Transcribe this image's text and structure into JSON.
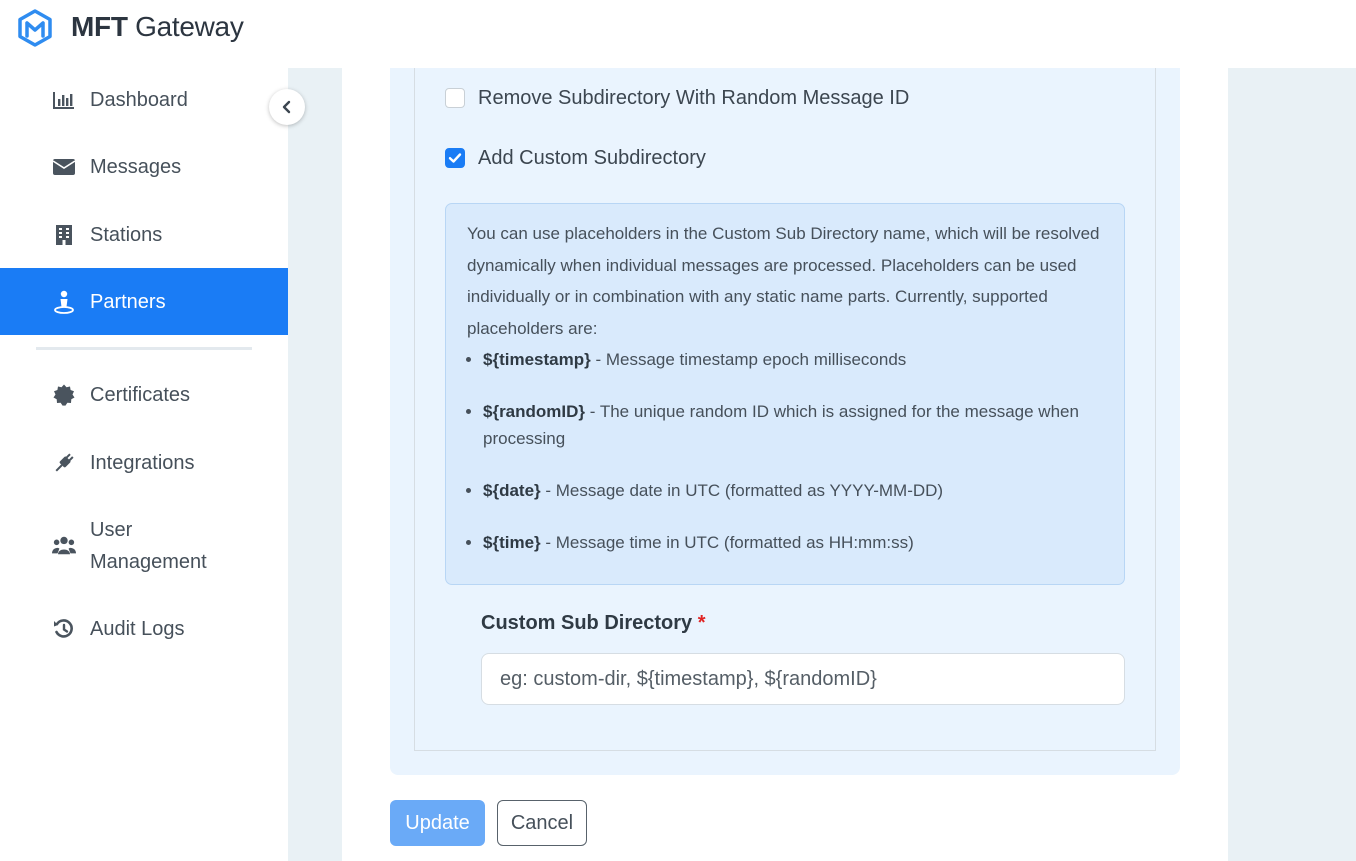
{
  "app": {
    "title_bold": "MFT",
    "title_light": "Gateway"
  },
  "sidebar": {
    "items": [
      {
        "label": "Dashboard",
        "icon": "bar-chart-icon"
      },
      {
        "label": "Messages",
        "icon": "envelope-icon"
      },
      {
        "label": "Stations",
        "icon": "building-icon"
      },
      {
        "label": "Partners",
        "icon": "user-pin-icon",
        "active": true
      },
      {
        "label": "Certificates",
        "icon": "certificate-icon"
      },
      {
        "label": "Integrations",
        "icon": "plug-icon"
      },
      {
        "label": "User",
        "label_line2": "Management",
        "icon": "users-icon"
      },
      {
        "label": "Audit Logs",
        "icon": "history-icon"
      }
    ],
    "collapse_icon": "chevron-left-icon"
  },
  "form": {
    "remove_subdir_label": "Remove Subdirectory With Random Message ID",
    "remove_subdir_checked": false,
    "add_custom_label": "Add Custom Subdirectory",
    "add_custom_checked": true,
    "info": {
      "intro": "You can use placeholders in the Custom Sub Directory name, which will be resolved dynamically when individual messages are processed. Placeholders can be used individually or in combination with any static name parts. Currently, supported placeholders are:",
      "placeholders": [
        {
          "key": "${timestamp}",
          "desc": " - Message timestamp epoch milliseconds"
        },
        {
          "key": "${randomID}",
          "desc": " - The unique random ID which is assigned for the message when processing"
        },
        {
          "key": "${date}",
          "desc": " - Message date in UTC (formatted as YYYY-MM-DD)"
        },
        {
          "key": "${time}",
          "desc": " - Message time in UTC (formatted as HH:mm:ss)"
        }
      ]
    },
    "custom_dir_label": "Custom Sub Directory",
    "required_mark": "*",
    "custom_dir_placeholder": "eg: custom-dir, ${timestamp}, ${randomID}",
    "custom_dir_value": ""
  },
  "actions": {
    "update": "Update",
    "cancel": "Cancel"
  },
  "colors": {
    "accent": "#1a7cf5",
    "update_button": "#6aaaf7",
    "info_bg": "#d9eafc",
    "required": "#e02424"
  }
}
